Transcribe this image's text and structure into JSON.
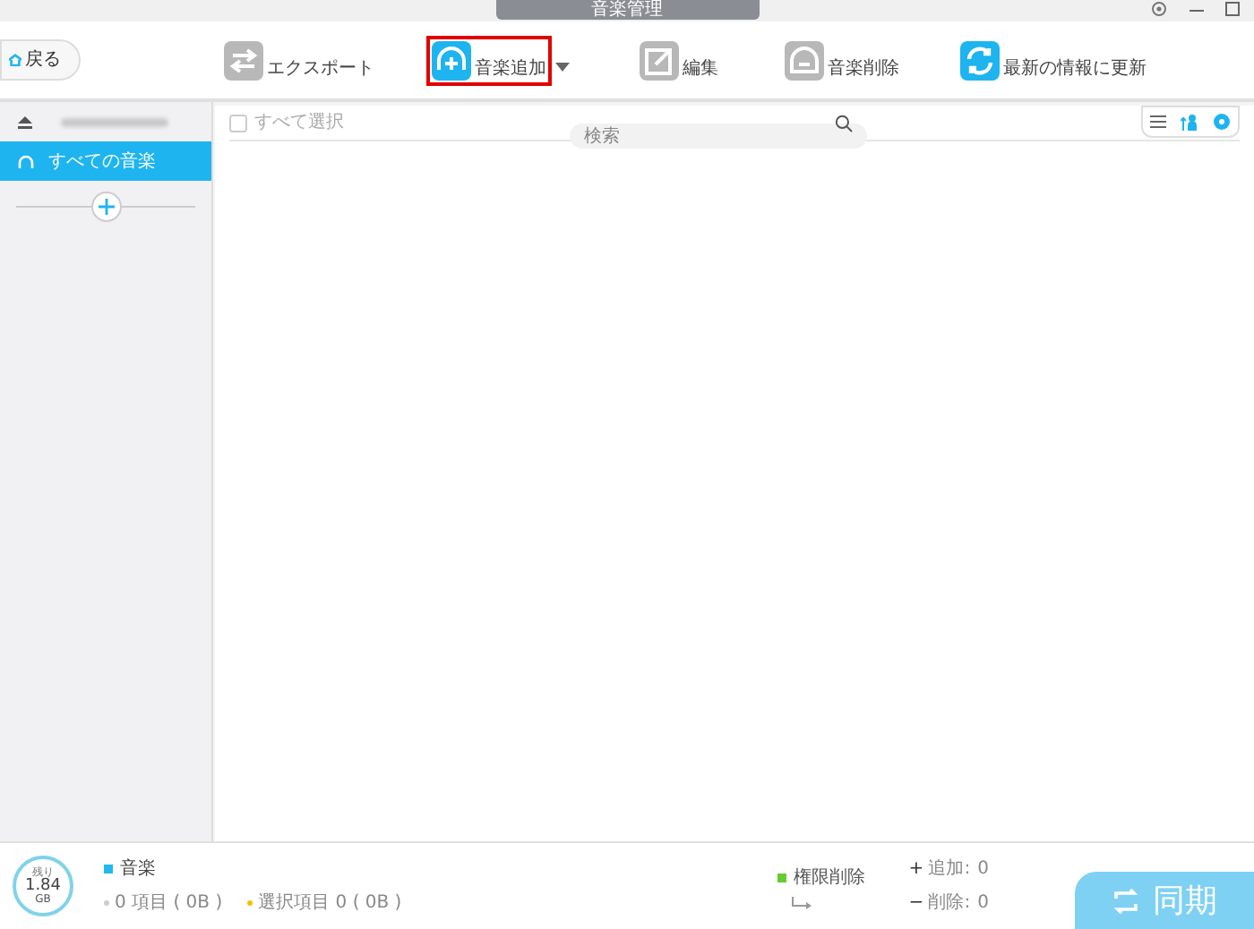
{
  "window": {
    "title": "音楽管理"
  },
  "back_button": {
    "label": "戻る"
  },
  "toolbar": [
    {
      "kind": "export",
      "label": "エクスポート",
      "highlighted": false,
      "has_menu": false
    },
    {
      "kind": "add",
      "label": "音楽追加",
      "highlighted": true,
      "has_menu": true
    },
    {
      "kind": "edit",
      "label": "編集",
      "highlighted": false,
      "has_menu": false
    },
    {
      "kind": "delete",
      "label": "音楽削除",
      "highlighted": false,
      "has_menu": false
    },
    {
      "kind": "refresh",
      "label": "最新の情報に更新",
      "highlighted": false,
      "has_menu": false
    }
  ],
  "sidebar": {
    "items": [
      {
        "label": "すべての音楽",
        "selected": true
      }
    ]
  },
  "list_header": {
    "select_all": {
      "label": "すべて選択",
      "checked": false
    },
    "search": {
      "placeholder": "検索"
    }
  },
  "footer": {
    "storage": {
      "caption": "残り",
      "value": "1.84",
      "unit": "GB"
    },
    "legend": [
      {
        "label": "音楽",
        "color": "#22b8f0"
      }
    ],
    "counts": [
      {
        "label": "0 項目 ( 0B )",
        "color": "#cccccc"
      },
      {
        "label": "選択項目 0 ( 0B )",
        "color": "#f5c000"
      }
    ],
    "permission": {
      "label": "権限削除",
      "color": "#66cc33"
    },
    "changes": [
      {
        "sign": "+",
        "label": "追加:",
        "value": "0"
      },
      {
        "sign": "−",
        "label": "削除:",
        "value": "0"
      }
    ],
    "sync_button": {
      "label": "同期"
    }
  }
}
